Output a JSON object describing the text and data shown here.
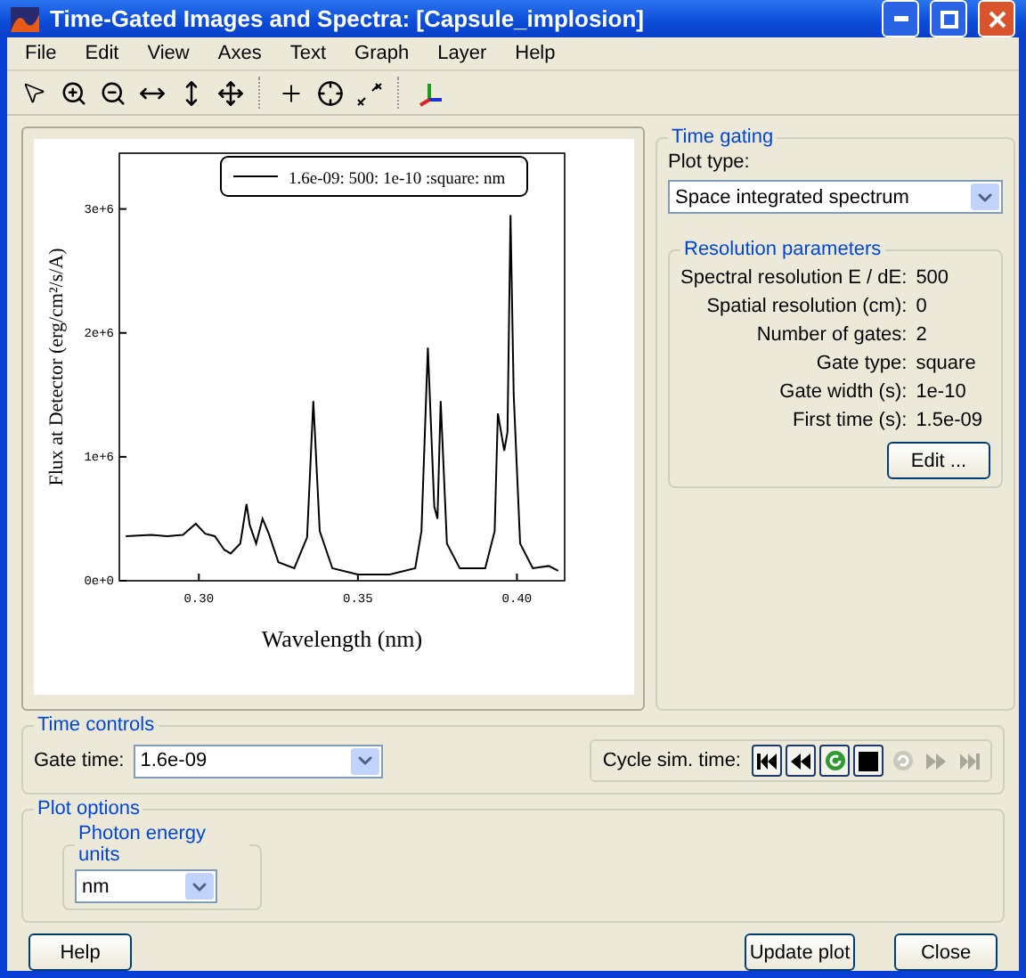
{
  "window": {
    "title": "Time-Gated Images and Spectra: [Capsule_implosion]"
  },
  "menu": [
    "File",
    "Edit",
    "View",
    "Axes",
    "Text",
    "Graph",
    "Layer",
    "Help"
  ],
  "plot": {
    "chart_data": {
      "type": "line",
      "xlabel": "Wavelength (nm)",
      "ylabel": "Flux at Detector (erg/cm²/s/A)",
      "xlim": [
        0.275,
        0.415
      ],
      "ylim": [
        0,
        3450000
      ],
      "xticks": [
        {
          "value": 0.3,
          "label": "0.30"
        },
        {
          "value": 0.35,
          "label": "0.35"
        },
        {
          "value": 0.4,
          "label": "0.40"
        }
      ],
      "yticks": [
        {
          "value": 0,
          "label": "0e+0"
        },
        {
          "value": 1000000,
          "label": "1e+6"
        },
        {
          "value": 2000000,
          "label": "2e+6"
        },
        {
          "value": 3000000,
          "label": "3e+6"
        }
      ],
      "x": [
        0.277,
        0.285,
        0.29,
        0.295,
        0.299,
        0.302,
        0.305,
        0.308,
        0.31,
        0.313,
        0.315,
        0.316,
        0.318,
        0.32,
        0.322,
        0.325,
        0.33,
        0.334,
        0.336,
        0.338,
        0.342,
        0.35,
        0.36,
        0.368,
        0.37,
        0.372,
        0.374,
        0.375,
        0.376,
        0.378,
        0.382,
        0.39,
        0.393,
        0.394,
        0.395,
        0.396,
        0.397,
        0.398,
        0.399,
        0.401,
        0.405,
        0.41,
        0.413
      ],
      "series": [
        {
          "name": "1.6e-09: 500: 1e-10 :square: nm",
          "color": "#000000",
          "values": [
            360000,
            370000,
            360000,
            370000,
            460000,
            380000,
            360000,
            250000,
            220000,
            300000,
            620000,
            450000,
            300000,
            500000,
            380000,
            150000,
            100000,
            350000,
            1450000,
            400000,
            100000,
            50000,
            50000,
            100000,
            400000,
            1880000,
            600000,
            500000,
            1450000,
            300000,
            100000,
            100000,
            400000,
            1350000,
            1200000,
            1050000,
            1200000,
            2950000,
            1500000,
            300000,
            100000,
            120000,
            80000
          ]
        }
      ]
    }
  },
  "time_gating": {
    "title": "Time gating",
    "plot_type_label": "Plot type:",
    "plot_type": "Space integrated spectrum",
    "resolution": {
      "title": "Resolution parameters",
      "params": [
        {
          "label": "Spectral resolution E / dE:",
          "value": "500"
        },
        {
          "label": "Spatial resolution (cm):",
          "value": "0"
        },
        {
          "label": "Number of gates:",
          "value": "2"
        },
        {
          "label": "Gate type:",
          "value": "square"
        },
        {
          "label": "Gate width (s):",
          "value": "1e-10"
        },
        {
          "label": "First time (s):",
          "value": "1.5e-09"
        }
      ],
      "edit_button": "Edit ..."
    }
  },
  "time_controls": {
    "title": "Time controls",
    "gate_time_label": "Gate time:",
    "gate_time": "1.6e-09",
    "cycle_label": "Cycle sim. time:",
    "cycle_buttons": [
      {
        "kind": "first",
        "disabled": false
      },
      {
        "kind": "rewind",
        "disabled": false
      },
      {
        "kind": "refresh",
        "disabled": false
      },
      {
        "kind": "stop",
        "disabled": false
      },
      {
        "kind": "step",
        "disabled": true
      },
      {
        "kind": "forward",
        "disabled": true
      },
      {
        "kind": "last",
        "disabled": true
      }
    ]
  },
  "plot_options": {
    "title": "Plot options",
    "units_title": "Photon energy units",
    "units": "nm"
  },
  "buttons": {
    "help": "Help",
    "update": "Update plot",
    "close": "Close"
  }
}
